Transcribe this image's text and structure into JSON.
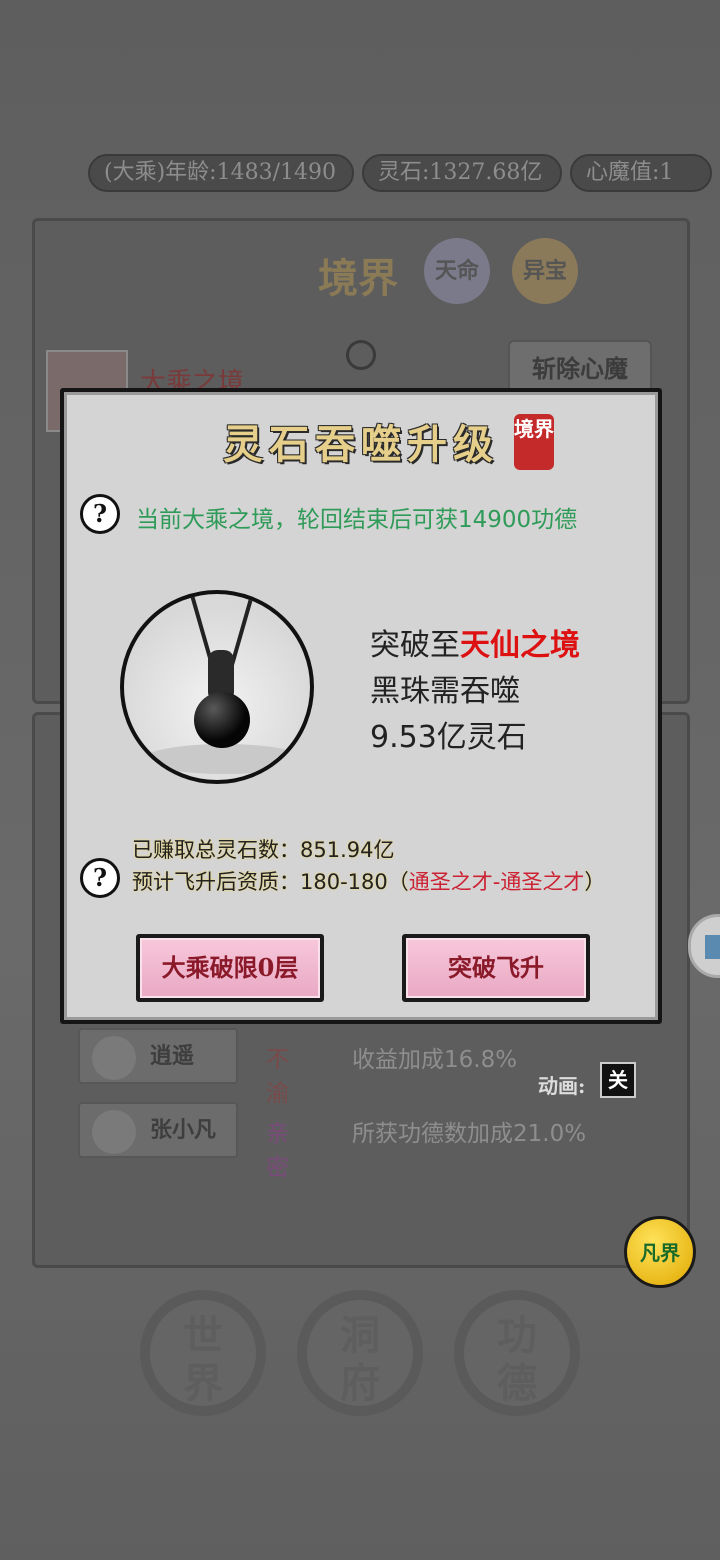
{
  "status_bar": {
    "age": "(大乘)年龄:1483/1490",
    "spirit_stones": "灵石:1327.68亿",
    "heart_demon": "心魔值:1"
  },
  "background": {
    "title": "境界",
    "btn_destiny": "天命",
    "btn_treasure": "异宝",
    "realm_name": "大乘之境",
    "slay_button": "斩除心魔",
    "friends": [
      {
        "name": "逍遥",
        "relation": "不渝",
        "relation_color": "#7a4a4a",
        "bonus": "收益加成16.8%"
      },
      {
        "name": "张小凡",
        "relation": "亲密",
        "relation_color": "#7a4a7a",
        "bonus": "所获功德数加成21.0%"
      }
    ],
    "anim_label": "动画:",
    "anim_toggle": "关",
    "fan_button": "凡界",
    "nav": [
      {
        "top": "世",
        "bottom": "界"
      },
      {
        "top": "洞",
        "bottom": "府"
      },
      {
        "top": "功",
        "bottom": "德"
      }
    ]
  },
  "dialog": {
    "title": "灵石吞噬升级",
    "seal": "境界",
    "info": "当前大乘之境，轮回结束后可获14900功德",
    "breakthrough_prefix": "突破至",
    "breakthrough_target": "天仙之境",
    "line2": "黑珠需吞噬",
    "line3": "9.53亿灵石",
    "earned": "已赚取总灵石数：851.94亿",
    "forecast_prefix": "预计飞升后资质：180-180（",
    "forecast_quality": "通圣之才-通圣之才",
    "forecast_suffix": "）",
    "button_left": "大乘破限0层",
    "button_right": "突破飞升",
    "help_glyph": "?"
  },
  "colors": {
    "dialog_bg": "#d4d4d4",
    "accent_red": "#dd1111",
    "info_green": "#2f9b58",
    "button_pink": "#f2b6cf"
  }
}
